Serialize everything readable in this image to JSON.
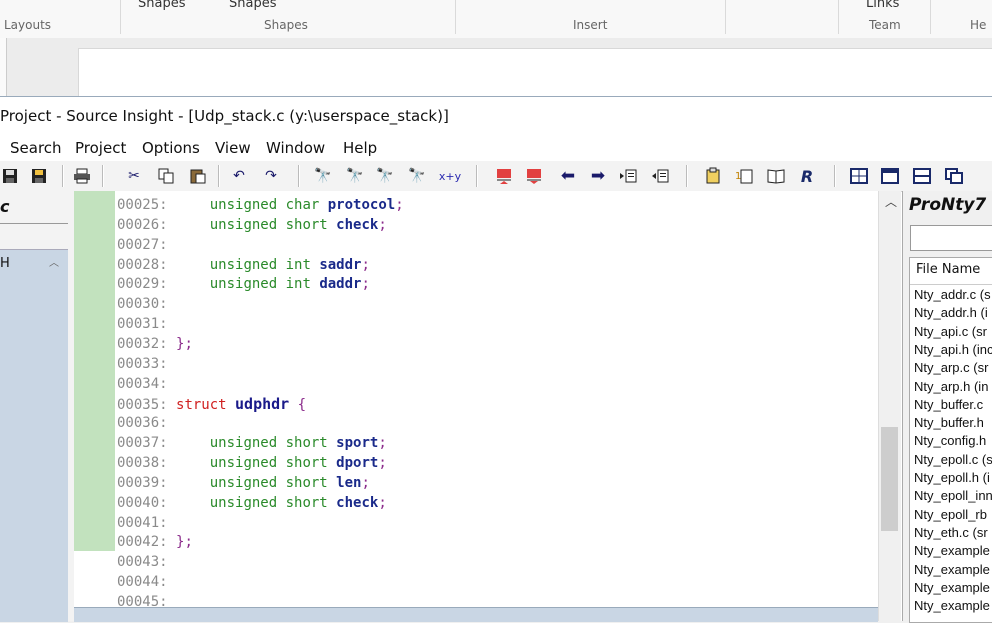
{
  "ribbon": {
    "top_labels": [
      "Shapes",
      "Shapes",
      "Links"
    ],
    "groups": [
      "Layouts",
      "Shapes",
      "Insert",
      "Team",
      "He"
    ]
  },
  "window": {
    "title": "Project - Source Insight - [Udp_stack.c (y:\\userspace_stack)]"
  },
  "menu": [
    "Search",
    "Project",
    "Options",
    "View",
    "Window",
    "Help"
  ],
  "toolbar": {
    "icons": [
      "save-icon",
      "save-all-icon",
      "print-icon",
      "cut-icon",
      "copy-icon",
      "paste-icon",
      "undo-icon",
      "redo-icon",
      "find-icon",
      "find-prev-icon",
      "find-next-icon",
      "search-files-icon",
      "replace-icon",
      "bookmark-prev-icon",
      "bookmark-next-icon",
      "back-icon",
      "forward-icon",
      "indent-icon",
      "outdent-icon",
      "browse-icon",
      "symbol-icon",
      "book-icon",
      "project-icon",
      "window-tile-icon",
      "window-horiz-icon",
      "window-split-icon",
      "window-cascade-icon"
    ],
    "replace_label": "x+y"
  },
  "left_panel": {
    "title": "c",
    "item": "H"
  },
  "editor": {
    "lines": [
      {
        "num": "00025:",
        "type": "unsigned char ",
        "name": "protocol",
        "end": ";"
      },
      {
        "num": "00026:",
        "type": "unsigned short ",
        "name": "check",
        "end": ";"
      },
      {
        "num": "00027:"
      },
      {
        "num": "00028:",
        "type": "unsigned int ",
        "name": "saddr",
        "end": ";"
      },
      {
        "num": "00029:",
        "type": "unsigned int ",
        "name": "daddr",
        "end": ";"
      },
      {
        "num": "00030:"
      },
      {
        "num": "00031:"
      },
      {
        "num": "00032:",
        "punct": "};"
      },
      {
        "num": "00033:"
      },
      {
        "num": "00034:"
      },
      {
        "num": "00035:",
        "struct_kw": "struct",
        "struct_name": "udphdr",
        "brace": "{"
      },
      {
        "num": "00036:"
      },
      {
        "num": "00037:",
        "type": "unsigned short ",
        "name": "sport",
        "end": ";"
      },
      {
        "num": "00038:",
        "type": "unsigned short ",
        "name": "dport",
        "end": ";"
      },
      {
        "num": "00039:",
        "type": "unsigned short ",
        "name": "len",
        "end": ";"
      },
      {
        "num": "00040:",
        "type": "unsigned short ",
        "name": "check",
        "end": ";"
      },
      {
        "num": "00041:"
      },
      {
        "num": "00042:",
        "punct": "};"
      },
      {
        "num": "00043:"
      },
      {
        "num": "00044:"
      },
      {
        "num": "00045:"
      }
    ]
  },
  "right_panel": {
    "title": "ProNty7",
    "header": "File Name",
    "files": [
      "Nty_addr.c (s",
      "Nty_addr.h (i",
      "Nty_api.c (sr",
      "Nty_api.h (inc",
      "Nty_arp.c (sr",
      "Nty_arp.h (in",
      "Nty_buffer.c",
      "Nty_buffer.h",
      "Nty_config.h",
      "Nty_epoll.c (s",
      "Nty_epoll.h (i",
      "Nty_epoll_inn",
      "Nty_epoll_rb",
      "Nty_eth.c (sr",
      "Nty_example",
      "Nty_example",
      "Nty_example",
      "Nty_example"
    ]
  },
  "colors": {
    "keyword_type": "#2a8a2a",
    "keyword_struct": "#d02020",
    "identifier": "#1a2a8a",
    "gutter": "#a8d5a2",
    "panel_list": "#c9d6e4"
  }
}
